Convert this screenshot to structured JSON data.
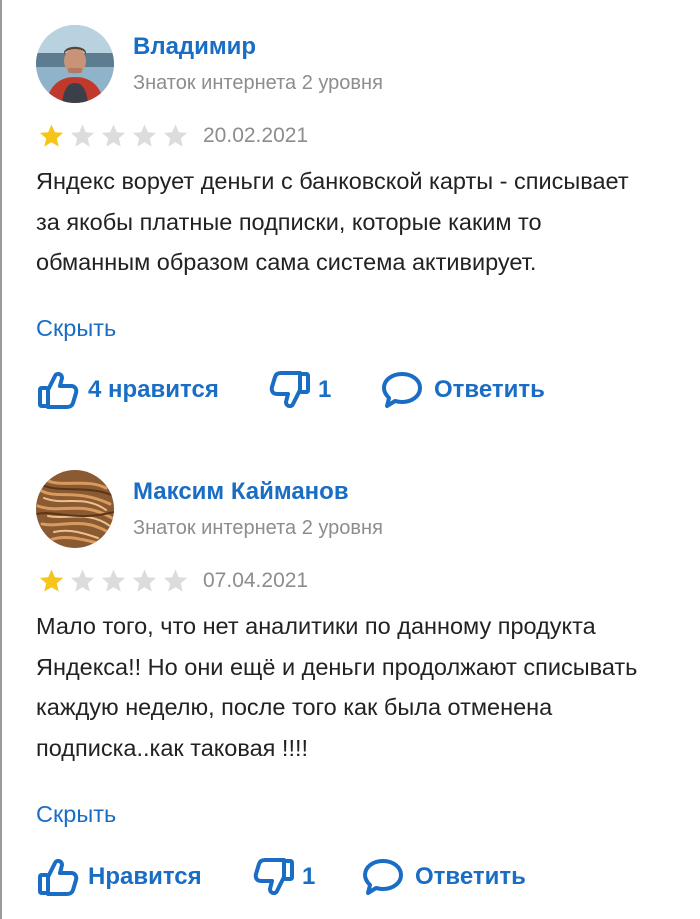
{
  "reviews": [
    {
      "author": "Владимир",
      "level": "Знаток интернета 2 уровня",
      "rating": 1,
      "max_rating": 5,
      "date": "20.02.2021",
      "text": "Яндекс ворует деньги с банковской карты - списывает за якобы платные подписки, которые каким то обманным образом сама система активирует.",
      "toggle_label": "Скрыть",
      "like_label": "4 нравится",
      "dislike_count": "1",
      "reply_label": "Ответить"
    },
    {
      "author": "Максим Кайманов",
      "level": "Знаток интернета 2 уровня",
      "rating": 1,
      "max_rating": 5,
      "date": "07.04.2021",
      "text": "Мало того, что нет аналитики по данному продукта Яндекса!! Но они ещё и деньги продолжают списывать каждую неделю, после того как была отменена подписка..как таковая !!!!",
      "toggle_label": "Скрыть",
      "like_label": "Нравится",
      "dislike_count": "1",
      "reply_label": "Ответить"
    }
  ],
  "colors": {
    "link": "#1a6dc4",
    "muted": "#8d8d8d",
    "star_active": "#f7c519",
    "star_inactive": "#dcdcdc"
  },
  "icons": {
    "like": "thumbs-up-icon",
    "dislike": "thumbs-down-icon",
    "reply": "speech-bubble-icon",
    "star": "star-icon"
  }
}
